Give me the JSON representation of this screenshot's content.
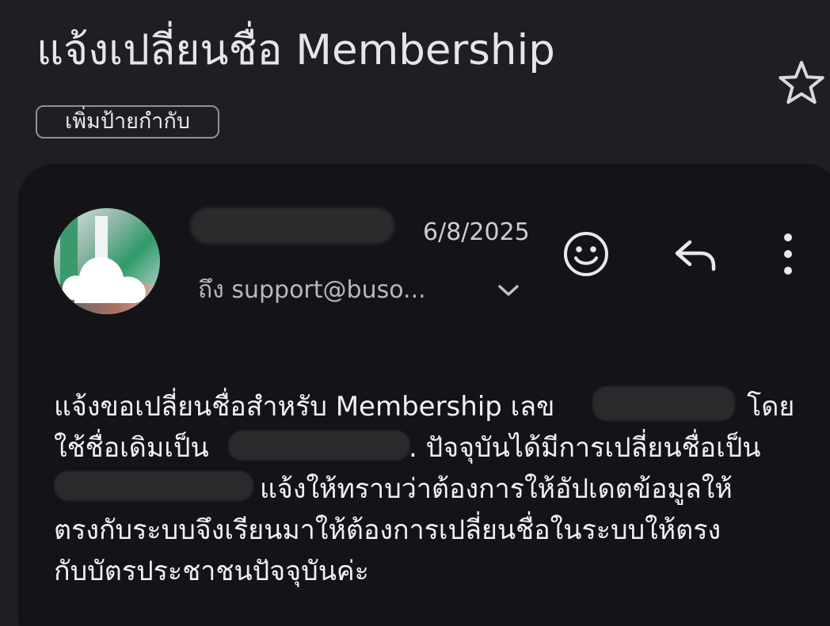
{
  "email": {
    "subject": "แจ้งเปลี่ยนชื่อ Membership",
    "label_chip": "เพิ่มป้ายกำกับ",
    "date": "6/8/2025",
    "to_line": "ถึง support@buso...",
    "body_lines": [
      "แจ้งขอเปลี่ยนชื่อสำหรับ Membership เลข",
      "โดย",
      "ใช้ชื่อเดิมเป็น",
      ". ปัจจุบันได้มีการเปลี่ยนชื่อเป็น",
      "แจ้งให้ทราบว่าต้องการให้อัปเดตข้อมูลให้",
      "ตรงกับระบบจึงเรียนมาให้ต้องการเปลี่ยนชื่อในระบบให้ตรง",
      "กับบัตรประชาชนปัจจุบันค่ะ"
    ]
  },
  "icons": {
    "star": "star-icon",
    "emoji": "smiley-icon",
    "reply": "reply-icon",
    "more": "more-vertical-icon",
    "expand": "chevron-down-icon"
  },
  "colors": {
    "background": "#1f1f23",
    "card": "#141418",
    "text": "#f0f1f3"
  }
}
